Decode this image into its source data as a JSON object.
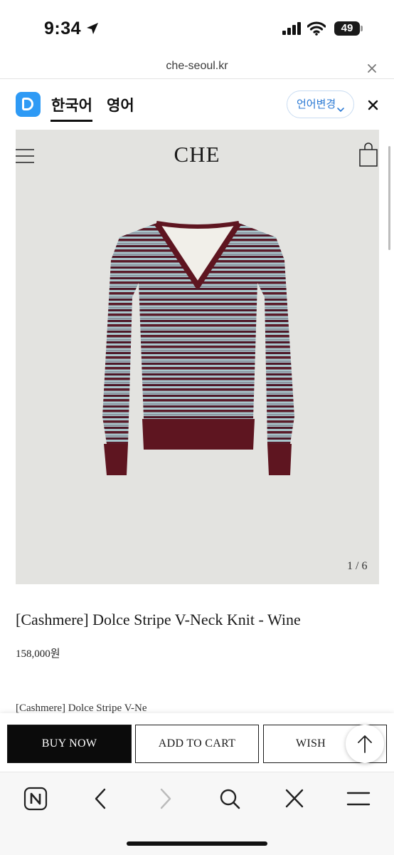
{
  "status_bar": {
    "time": "9:34",
    "battery": "49"
  },
  "url_bar": {
    "url": "che-seoul.kr"
  },
  "translate_bar": {
    "lang_korean": "한국어",
    "lang_english": "영어",
    "change_language": "언어변경"
  },
  "site": {
    "brand": "CHE",
    "image_pager": "1 / 6",
    "product_title": "[Cashmere] Dolce Stripe V-Neck Knit - Wine",
    "product_price": "158,000원",
    "sub_title": "[Cashmere] Dolce Stripe V-Ne"
  },
  "actions": {
    "buy_now": "BUY NOW",
    "add_to_cart": "ADD TO CART",
    "wish": "WISH"
  },
  "icons": {
    "status": [
      "location-arrow-icon",
      "signal-icon",
      "wifi-icon",
      "battery-icon"
    ],
    "toolbar": [
      "naver-home-icon",
      "back-icon",
      "forward-icon",
      "search-icon",
      "close-icon",
      "menu-icon"
    ]
  },
  "colors": {
    "accent_blue": "#2e9af5",
    "sweater_wine": "#6b1a24",
    "sweater_stripe_light": "#a9c6cc",
    "button_black": "#0b0b0b"
  }
}
